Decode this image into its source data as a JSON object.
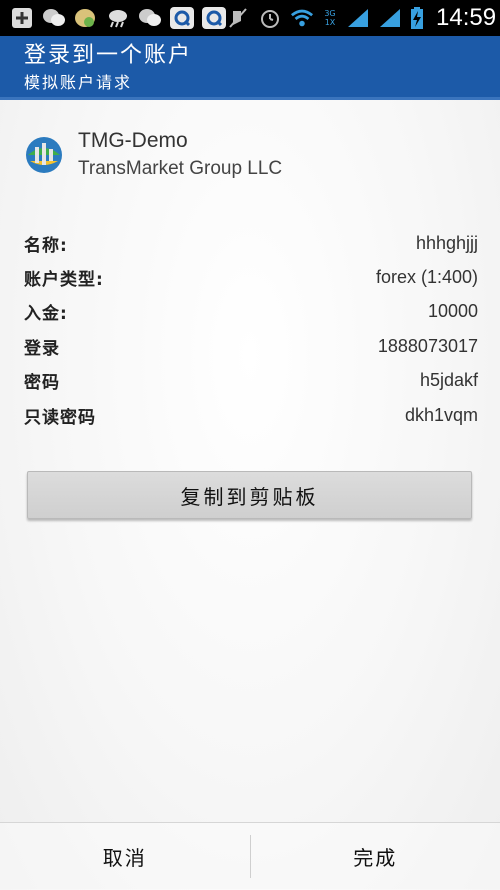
{
  "status_bar": {
    "time": "14:59",
    "icons": [
      "add-icon",
      "wechat-icon",
      "game-icon",
      "weather-icon",
      "wechat-icon",
      "q-app-icon",
      "q-app-icon",
      "mute-icon",
      "alarm-icon",
      "wifi-icon",
      "3g-signal-icon",
      "signal-icon",
      "battery-charging-icon"
    ],
    "network_labels": [
      "3G",
      "1X"
    ]
  },
  "header": {
    "title": "登录到一个账户",
    "subtitle": "模拟账户请求",
    "background": "#1c5aa8"
  },
  "account": {
    "name": "TMG-Demo",
    "company": "TransMarket Group LLC",
    "logo_icon": "metatrader-logo-icon"
  },
  "details": [
    {
      "label": "名称:",
      "value": "hhhghjjj"
    },
    {
      "label": "账户类型:",
      "value": "forex (1:400)"
    },
    {
      "label": "入金:",
      "value": "10000"
    },
    {
      "label": "登录",
      "value": "1888073017"
    },
    {
      "label": "密码",
      "value": "h5jdakf"
    },
    {
      "label": "只读密码",
      "value": "dkh1vqm"
    }
  ],
  "copy_button": "复制到剪贴板",
  "footer": {
    "cancel": "取消",
    "done": "完成"
  }
}
